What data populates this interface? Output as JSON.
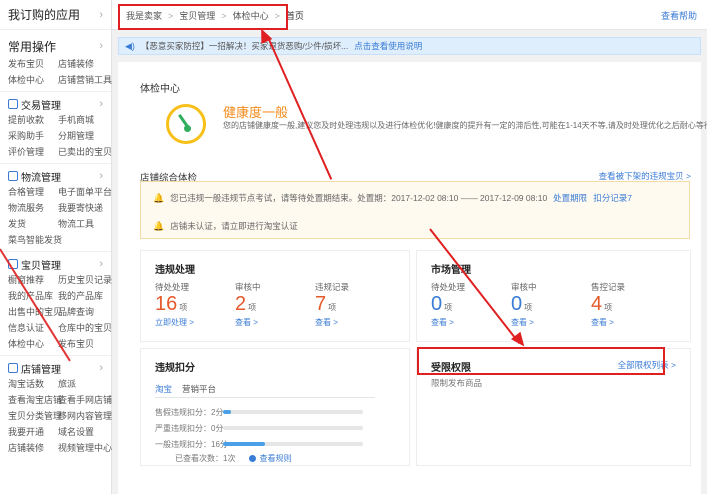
{
  "sidebar": {
    "header": "我订购的应用",
    "common": {
      "title": "常用操作",
      "items": [
        "发布宝贝",
        "店铺装修",
        "体检中心",
        "店铺营销工具"
      ]
    },
    "sections": [
      {
        "title": "交易管理",
        "icon": "trade-icon",
        "items": [
          "提前收款",
          "手机商城",
          "采购助手",
          "分期管理",
          "评价管理",
          "已卖出的宝贝"
        ]
      },
      {
        "title": "物流管理",
        "icon": "logistics-icon",
        "items": [
          "合格管理",
          "电子面单平台",
          "物流服务",
          "我要寄快递",
          "发货",
          "物流工具",
          "菜鸟智能发货"
        ]
      },
      {
        "title": "宝贝管理",
        "icon": "goods-icon",
        "items": [
          "橱窗推荐",
          "历史宝贝记录",
          "我的产品库",
          "我的产品库",
          "出售中的宝贝",
          "品牌查询",
          "信息认证",
          "仓库中的宝贝",
          "体检中心",
          "发布宝贝"
        ]
      },
      {
        "title": "店铺管理",
        "icon": "shop-icon",
        "items": [
          "淘宝话数",
          "旅派",
          "查看淘宝店铺",
          "查看手网店铺",
          "宝贝分类管理",
          "移网内容管理",
          "我要开通",
          "域名设置",
          "店铺装修",
          "视频管理中心"
        ]
      }
    ]
  },
  "topbar": {
    "breadcrumb": [
      "我是卖家",
      "宝贝管理",
      "体检中心",
      "首页"
    ],
    "help": "查看帮助"
  },
  "notice": {
    "text": "【恶意买家防控】一招解决！买家退货恶购/少件/损坏...",
    "link": "点击查看使用说明"
  },
  "health": {
    "panel_title": "体检中心",
    "level": "健康度一般",
    "desc": "您的店铺健康度一般,建议您及时处理违规以及进行体检优化!健康度的提升有一定的滞后性,可能在1-14天不等,请及时处理优化之后耐心等待"
  },
  "overall": {
    "title": "店铺综合体检",
    "link": "查看被下架的违规宝贝 >",
    "warn1": {
      "text": "您已违规一般违规节点考试，请等待处置期结束。处置期：2017-12-02 08:10 —— 2017-12-09 08:10",
      "link1": "处置期限",
      "link2": "扣分记录7"
    },
    "warn2": {
      "text": "店铺未认证，请立即进行淘宝认证",
      "link": "立即进行淘宝认证"
    }
  },
  "violations": {
    "title": "违规处理",
    "metrics": [
      {
        "label": "待处处理",
        "value": "16",
        "unit": "项",
        "link": "立即处理 >"
      },
      {
        "label": "审核中",
        "value": "2",
        "unit": "项",
        "link": "查看 >"
      },
      {
        "label": "违规记录",
        "value": "7",
        "unit": "项",
        "link": "查看 >"
      }
    ]
  },
  "market": {
    "title": "市场管理",
    "metrics": [
      {
        "label": "待处处理",
        "value": "0",
        "unit": "项",
        "link": "查看 >"
      },
      {
        "label": "审核中",
        "value": "0",
        "unit": "项",
        "link": "查看 >"
      },
      {
        "label": "售控记录",
        "value": "4",
        "unit": "项",
        "link": "查看 >"
      }
    ]
  },
  "deduct": {
    "title": "违规扣分",
    "tabs": [
      "淘宝",
      "营销平台"
    ],
    "rows": [
      {
        "label": "售假违规扣分：2分",
        "fraction": 0.06
      },
      {
        "label": "严重违规扣分：0分",
        "fraction": 0.0
      },
      {
        "label": "一般违规扣分：16分",
        "fraction": 0.3
      }
    ],
    "note": "已查看次数：1次",
    "rule_link": "查看规则"
  },
  "restrict": {
    "title": "受限权限",
    "link": "全部限权列表 >",
    "text": "限制发布商品"
  },
  "colors": {
    "accent": "#3a7bd5",
    "warning_orange": "#e55a2b",
    "annotation_red": "#e02020",
    "gauge_yellow": "#f6c019",
    "gauge_green": "#2fae5b"
  }
}
